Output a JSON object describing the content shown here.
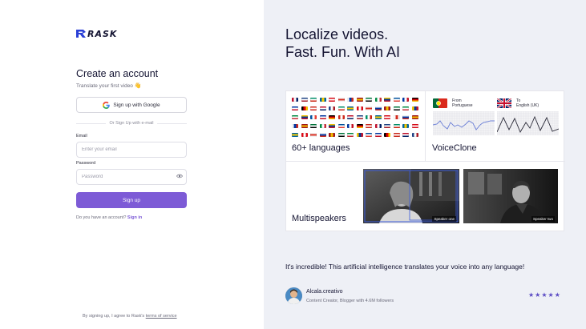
{
  "brand": {
    "name": "RASK",
    "accent": "#7d5bd6"
  },
  "signup": {
    "title": "Create an account",
    "subtitle": "Translate your first video",
    "subtitle_emoji": "👋",
    "google_label": "Sign up with Google",
    "divider_text": "Or Sign Up with e-mail",
    "email_label": "Email",
    "email_placeholder": "Enter your email",
    "password_label": "Password",
    "password_placeholder": "Password",
    "submit_label": "Sign up",
    "have_account_text": "Do you have an account?",
    "signin_link": "Sign in",
    "tos_text": "By signing up, I agree to Rask's",
    "tos_link": "terms of service"
  },
  "promo": {
    "headline_line1": "Localize videos.",
    "headline_line2": "Fast. Fun. With AI",
    "features": {
      "languages_title": "60+ languages",
      "voiceclone_title": "VoiceClone",
      "voiceclone_from_label": "From",
      "voiceclone_from_lang": "Portuguese",
      "voiceclone_to_label": "To",
      "voiceclone_to_lang": "English (UK)",
      "multispeakers_title": "Multispeakers",
      "speaker_one": "Speaker one",
      "speaker_two": "Speaker two"
    },
    "testimonial": {
      "quote": "It's incredible! This artificial intelligence translates your voice into any language!",
      "author": "Alcala.creativo",
      "role": "Content Creator, Blogger with 4.6M followers",
      "rating": 5,
      "stars": "★★★★★"
    }
  }
}
